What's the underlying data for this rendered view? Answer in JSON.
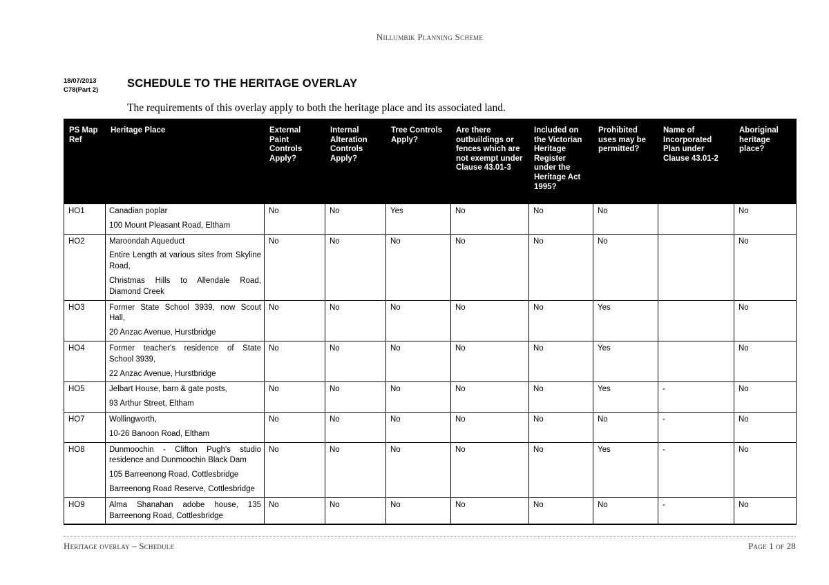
{
  "header": {
    "running_title": "Nillumbik Planning Scheme"
  },
  "title_block": {
    "date": "18/07/2013",
    "amendment": "C78(Part 2)",
    "title": "SCHEDULE TO THE HERITAGE OVERLAY"
  },
  "intro": "The requirements of this overlay apply to both the heritage place and its associated land.",
  "table": {
    "columns": [
      "PS Map Ref",
      "Heritage Place",
      "External Paint Controls Apply?",
      "Internal Alteration Controls Apply?",
      "Tree Controls Apply?",
      "Are there outbuildings or fences which are not exempt under Clause 43.01-3",
      "Included on the Victorian Heritage Register under the Heritage Act 1995?",
      "Prohibited uses may be permitted?",
      "Name of Incorporated Plan under Clause  43.01-2",
      "Aboriginal heritage place?"
    ],
    "rows": [
      {
        "ref": "HO1",
        "place": [
          "Canadian poplar",
          "100 Mount Pleasant Road, Eltham"
        ],
        "external_paint": "No",
        "internal_alteration": "No",
        "tree_controls": "Yes",
        "outbuildings": "No",
        "vhr": "No",
        "prohibited_uses": "No",
        "incorporated_plan": "",
        "aboriginal": "No"
      },
      {
        "ref": "HO2",
        "place": [
          "Maroondah Aqueduct",
          "Entire Length at various sites from Skyline Road,",
          "Christmas Hills to Allendale Road, Diamond Creek"
        ],
        "external_paint": "No",
        "internal_alteration": "No",
        "tree_controls": "No",
        "outbuildings": "No",
        "vhr": "No",
        "prohibited_uses": "No",
        "incorporated_plan": "",
        "aboriginal": "No"
      },
      {
        "ref": "HO3",
        "place": [
          "Former State School 3939, now Scout Hall,",
          "20 Anzac Avenue, Hurstbridge"
        ],
        "external_paint": "No",
        "internal_alteration": "No",
        "tree_controls": "No",
        "outbuildings": "No",
        "vhr": "No",
        "prohibited_uses": "Yes",
        "incorporated_plan": "",
        "aboriginal": "No"
      },
      {
        "ref": "HO4",
        "place": [
          "Former teacher's residence of State School 3939,",
          "22  Anzac Avenue, Hurstbridge"
        ],
        "external_paint": "No",
        "internal_alteration": "No",
        "tree_controls": "No",
        "outbuildings": "No",
        "vhr": "No",
        "prohibited_uses": "Yes",
        "incorporated_plan": "",
        "aboriginal": "No"
      },
      {
        "ref": "HO5",
        "place": [
          "Jelbart House, barn & gate posts,",
          "93 Arthur Street, Eltham"
        ],
        "external_paint": "No",
        "internal_alteration": "No",
        "tree_controls": "No",
        "outbuildings": "No",
        "vhr": "No",
        "prohibited_uses": "Yes",
        "incorporated_plan": "-",
        "aboriginal": "No"
      },
      {
        "ref": "HO7",
        "place": [
          "Wollingworth,",
          "10-26 Banoon Road, Eltham"
        ],
        "external_paint": "No",
        "internal_alteration": "No",
        "tree_controls": "No",
        "outbuildings": "No",
        "vhr": "No",
        "prohibited_uses": "No",
        "incorporated_plan": "-",
        "aboriginal": "No"
      },
      {
        "ref": "HO8",
        "place": [
          "Dunmoochin - Clifton Pugh's studio residence and Dunmoochin Black Dam",
          "105 Barreenong Road, Cottlesbridge",
          "Barreenong Road Reserve, Cottlesbridge"
        ],
        "external_paint": "No",
        "internal_alteration": "No",
        "tree_controls": "No",
        "outbuildings": "No",
        "vhr": "No",
        "prohibited_uses": "Yes",
        "incorporated_plan": "-",
        "aboriginal": "No"
      },
      {
        "ref": "HO9",
        "place": [
          "Alma Shanahan adobe house, 135 Barreenong Road, Cottlesbridge"
        ],
        "external_paint": "No",
        "internal_alteration": "No",
        "tree_controls": "No",
        "outbuildings": "No",
        "vhr": "No",
        "prohibited_uses": "No",
        "incorporated_plan": "-",
        "aboriginal": "No"
      }
    ]
  },
  "footer": {
    "left": "Heritage overlay – Schedule",
    "right": "Page 1 of 28"
  }
}
